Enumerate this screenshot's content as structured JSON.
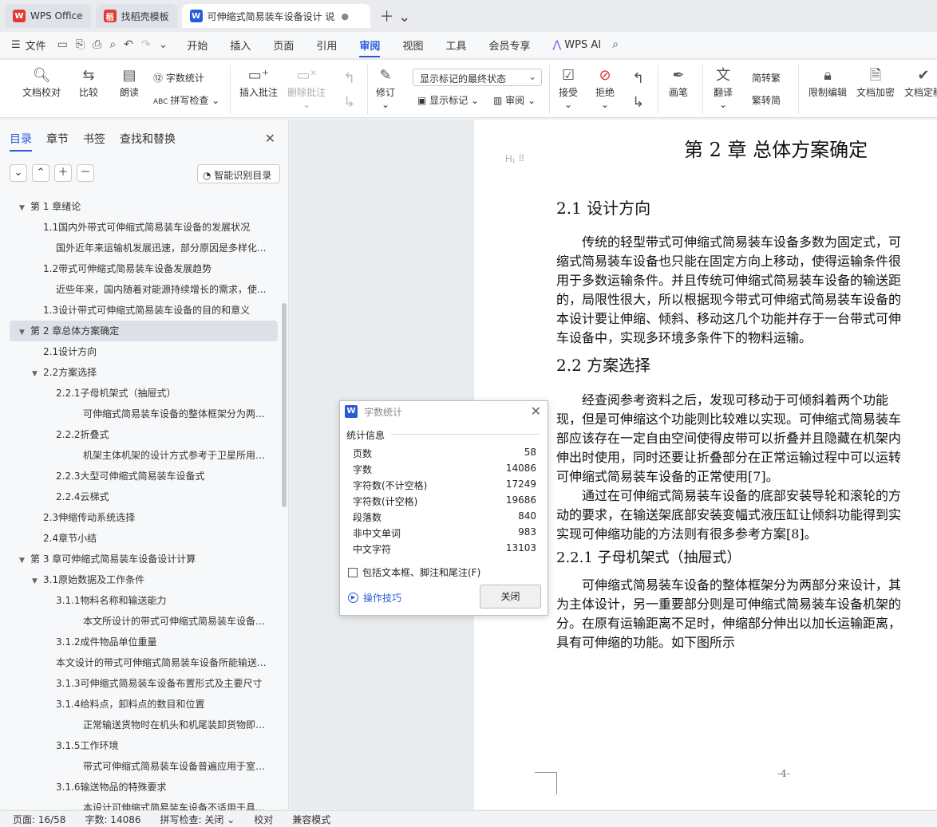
{
  "tabs": [
    {
      "label": "WPS Office",
      "icon": "wps-logo-icon",
      "color": "#e53935",
      "glyph": "W"
    },
    {
      "label": "找稻壳模板",
      "icon": "docer-icon",
      "color": "#e53935",
      "glyph": "稻"
    },
    {
      "label": "可伸缩式简易装车设备设计 说",
      "icon": "writer-icon",
      "color": "#2a5bd7",
      "glyph": "W"
    }
  ],
  "menubar": {
    "file": "文件",
    "tabs": [
      "开始",
      "插入",
      "页面",
      "引用",
      "审阅",
      "视图",
      "工具",
      "会员专享"
    ],
    "active": "审阅",
    "ai": "WPS AI"
  },
  "ribbon": {
    "doc_check": "文档校对",
    "compare": "比较",
    "read_aloud": "朗读",
    "word_count": "字数统计",
    "spell_check": "拼写检查",
    "insert_comment": "插入批注",
    "delete_comment": "删除批注",
    "track": "修订",
    "markup_state": "显示标记的最终状态",
    "show_markup": "显示标记",
    "review_pane": "审阅",
    "accept": "接受",
    "reject": "拒绝",
    "pen": "画笔",
    "translate": "翻译",
    "to_trad": "简转繁",
    "to_simp": "繁转简",
    "restrict": "限制编辑",
    "encrypt": "文档加密",
    "finalize": "文档定稿"
  },
  "nav": {
    "tabs": [
      "目录",
      "章节",
      "书签",
      "查找和替换"
    ],
    "smart_btn": "智能识别目录",
    "items": [
      {
        "text": "第 1 章绪论",
        "level": 0,
        "arrow": "▼"
      },
      {
        "text": "1.1国内外带式可伸缩式简易装车设备的发展状况",
        "level": 1,
        "arrow": ""
      },
      {
        "text": "国外近年来运输机发展迅速，部分原因是多样化...",
        "level": 2,
        "arrow": ""
      },
      {
        "text": "1.2带式可伸缩式简易装车设备发展趋势",
        "level": 1,
        "arrow": ""
      },
      {
        "text": "近些年来，国内随着对能源持续增长的需求，使...",
        "level": 2,
        "arrow": ""
      },
      {
        "text": "1.3设计带式可伸缩式简易装车设备的目的和意义",
        "level": 1,
        "arrow": ""
      },
      {
        "text": "第 2 章总体方案确定",
        "level": 0,
        "arrow": "▼",
        "selected": true
      },
      {
        "text": "2.1设计方向",
        "level": 1,
        "arrow": ""
      },
      {
        "text": "2.2方案选择",
        "level": 1,
        "arrow": "▼"
      },
      {
        "text": "2.2.1子母机架式（抽屉式）",
        "level": 2,
        "arrow": ""
      },
      {
        "text": "可伸缩式简易装车设备的整体框架分为两部...",
        "level": 3,
        "arrow": ""
      },
      {
        "text": "2.2.2折叠式",
        "level": 2,
        "arrow": ""
      },
      {
        "text": "机架主体机架的设计方式参考于卫星所用的折...",
        "level": 3,
        "arrow": ""
      },
      {
        "text": "2.2.3大型可伸缩式简易装车设备式",
        "level": 2,
        "arrow": ""
      },
      {
        "text": "2.2.4云梯式",
        "level": 2,
        "arrow": ""
      },
      {
        "text": "2.3伸缩传动系统选择",
        "level": 1,
        "arrow": ""
      },
      {
        "text": "2.4章节小结",
        "level": 1,
        "arrow": ""
      },
      {
        "text": "第 3 章可伸缩式简易装车设备设计计算",
        "level": 0,
        "arrow": "▼"
      },
      {
        "text": "3.1原始数据及工作条件",
        "level": 1,
        "arrow": "▼"
      },
      {
        "text": "3.1.1物料名称和输送能力",
        "level": 2,
        "arrow": ""
      },
      {
        "text": "本文所设计的带式可伸缩式简易装车设备无...",
        "level": 3,
        "arrow": ""
      },
      {
        "text": "3.1.2成件物品单位重量",
        "level": 2,
        "arrow": ""
      },
      {
        "text": "本文设计的带式可伸缩式简易装车设备所能输送...",
        "level": 2,
        "arrow": ""
      },
      {
        "text": "3.1.3可伸缩式简易装车设备布置形式及主要尺寸",
        "level": 2,
        "arrow": ""
      },
      {
        "text": "3.1.4给料点，卸料点的数目和位置",
        "level": 2,
        "arrow": ""
      },
      {
        "text": "正常输送货物时在机头和机尾装卸货物即可...",
        "level": 3,
        "arrow": ""
      },
      {
        "text": "3.1.5工作环境",
        "level": 2,
        "arrow": ""
      },
      {
        "text": "带式可伸缩式简易装车设备普遍应用于室外...",
        "level": 3,
        "arrow": ""
      },
      {
        "text": "3.1.6输送物品的特殊要求",
        "level": 2,
        "arrow": ""
      },
      {
        "text": "本设计可伸缩式简易装车设备不适用于具有...",
        "level": 3,
        "arrow": ""
      }
    ]
  },
  "doc": {
    "h1": "第 2 章  总体方案确定",
    "h_mark": "H₁ ⠿",
    "s21": "2.1  设计方向",
    "p1": [
      "　　传统的轻型带式可伸缩式简易装车设备多数为固定式，可",
      "缩式简易装车设备也只能在固定方向上移动，使得运输条件很",
      "用于多数运输条件。并且传统可伸缩式简易装车设备的输送距",
      "的，局限性很大，所以根据现今带式可伸缩式简易装车设备的",
      "本设计要让伸缩、倾斜、移动这几个功能并存于一台带式可伸",
      "车设备中，实现多环境多条件下的物料运输。"
    ],
    "s22": "2.2  方案选择",
    "p2": [
      "　　经查阅参考资料之后，发现可移动于可倾斜着两个功能",
      "现，但是可伸缩这个功能则比较难以实现。可伸缩式简易装车",
      "部应该存在一定自由空间使得皮带可以折叠并且隐藏在机架内",
      "伸出时使用，同时还要让折叠部分在正常运输过程中可以运转",
      "可伸缩式简易装车设备的正常使用[7]。",
      "　　通过在可伸缩式简易装车设备的底部安装导轮和滚轮的方",
      "动的要求，在输送架底部安装变幅式液压缸让倾斜功能得到实",
      "实现可伸缩功能的方法则有很多参考方案[8]。"
    ],
    "s221": "2.2.1  子母机架式（抽屉式）",
    "p3": [
      "　　可伸缩式简易装车设备的整体框架分为两部分来设计，其",
      "为主体设计，另一重要部分则是可伸缩式简易装车设备机架的",
      "分。在原有运输距离不足时，伸缩部分伸出以加长运输距离，",
      "具有可伸缩的功能。如下图所示"
    ],
    "page_number": "-4-"
  },
  "dialog": {
    "title": "字数统计",
    "section": "统计信息",
    "rows": [
      {
        "label": "页数",
        "value": "58"
      },
      {
        "label": "字数",
        "value": "14086"
      },
      {
        "label": "字符数(不计空格)",
        "value": "17249"
      },
      {
        "label": "字符数(计空格)",
        "value": "19686"
      },
      {
        "label": "段落数",
        "value": "840"
      },
      {
        "label": "非中文单词",
        "value": "983"
      },
      {
        "label": "中文字符",
        "value": "13103"
      }
    ],
    "checkbox": "包括文本框、脚注和尾注(F)",
    "tips": "操作技巧",
    "close": "关闭"
  },
  "status": {
    "page": "页面: 16/58",
    "words": "字数: 14086",
    "spell": "拼写检查: 关闭 ⌄",
    "proof": "校对",
    "compat": "兼容模式"
  }
}
